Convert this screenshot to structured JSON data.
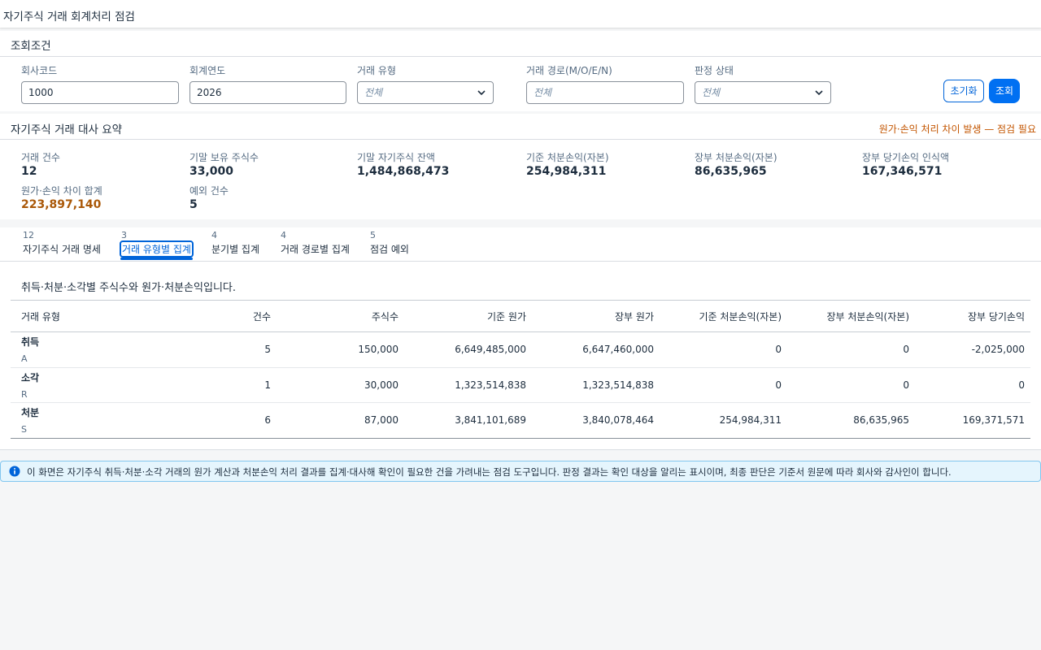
{
  "app": {
    "title": "자기주식 거래 회계처리 점검"
  },
  "filter": {
    "section_title": "조회조건",
    "company_code": {
      "label": "회사코드",
      "value": "1000"
    },
    "fiscal_year": {
      "label": "회계연도",
      "value": "2026"
    },
    "trade_type": {
      "label": "거래 유형",
      "placeholder": "전체"
    },
    "trade_path": {
      "label": "거래 경로(M/O/E/N)",
      "placeholder": "전체"
    },
    "judgement": {
      "label": "판정 상태",
      "placeholder": "전체"
    },
    "reset_label": "초기화",
    "search_label": "조회"
  },
  "summary": {
    "section_title": "자기주식 거래 대사 요약",
    "warning": "원가·손익 처리 차이 발생 — 점검 필요",
    "kpis": [
      {
        "label": "거래 건수",
        "value": "12"
      },
      {
        "label": "기말 보유 주식수",
        "value": "33,000"
      },
      {
        "label": "기말 자기주식 잔액",
        "value": "1,484,868,473"
      },
      {
        "label": "기준 처분손익(자본)",
        "value": "254,984,311"
      },
      {
        "label": "장부 처분손익(자본)",
        "value": "86,635,965"
      },
      {
        "label": "장부 당기손익 인식액",
        "value": "167,346,571"
      },
      {
        "label": "원가·손익 차이 합계",
        "value": "223,897,140"
      },
      {
        "label": "예외 건수",
        "value": "5"
      }
    ]
  },
  "tabs": [
    {
      "count": "12",
      "label": "자기주식 거래 명세"
    },
    {
      "count": "3",
      "label": "거래 유형별 집계"
    },
    {
      "count": "4",
      "label": "분기별 집계"
    },
    {
      "count": "4",
      "label": "거래 경로별 집계"
    },
    {
      "count": "5",
      "label": "점검 예외"
    }
  ],
  "content": {
    "description": "취득·처분·소각별 주식수와 원가·처분손익입니다.",
    "columns": [
      "거래 유형",
      "건수",
      "주식수",
      "기준 원가",
      "장부 원가",
      "기준 처분손익(자본)",
      "장부 처분손익(자본)",
      "장부 당기손익"
    ],
    "rows": [
      {
        "name": "취득",
        "code": "A",
        "count": "5",
        "shares": "150,000",
        "std_cost": "6,649,485,000",
        "book_cost": "6,647,460,000",
        "std_gain": "0",
        "book_gain": "0",
        "book_pl": "-2,025,000"
      },
      {
        "name": "소각",
        "code": "R",
        "count": "1",
        "shares": "30,000",
        "std_cost": "1,323,514,838",
        "book_cost": "1,323,514,838",
        "std_gain": "0",
        "book_gain": "0",
        "book_pl": "0"
      },
      {
        "name": "처분",
        "code": "S",
        "count": "6",
        "shares": "87,000",
        "std_cost": "3,841,101,689",
        "book_cost": "3,840,078,464",
        "std_gain": "254,984,311",
        "book_gain": "86,635,965",
        "book_pl": "169,371,571"
      }
    ]
  },
  "info": {
    "icon": "info-icon",
    "text": "이 화면은 자기주식 취득·처분·소각 거래의 원가 계산과 처분손익 처리 결과를 집계·대사해 확인이 필요한 건을 가려내는 점검 도구입니다. 판정 결과는 확인 대상을 알리는 표시이며, 최종 판단은 기준서 원문에 따라 회사와 감사인이 합니다."
  },
  "colors": {
    "accent": "#0070f2",
    "warning": "#c35500",
    "warning_value": "#aa5808",
    "info_bg": "#e5f5fd"
  }
}
